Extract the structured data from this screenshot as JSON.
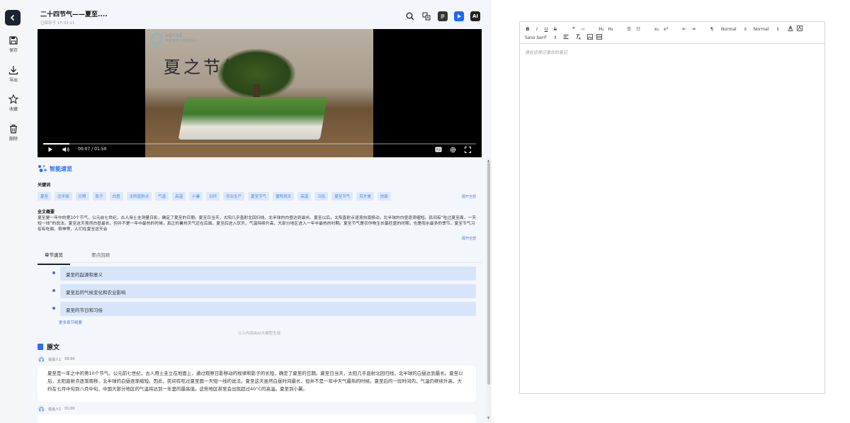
{
  "rail": {
    "back": "back",
    "items": [
      {
        "label": "保存",
        "icon": "save-icon"
      },
      {
        "label": "导出",
        "icon": "download-icon"
      },
      {
        "label": "收藏",
        "icon": "star-icon"
      },
      {
        "label": "删除",
        "icon": "trash-icon"
      }
    ]
  },
  "header": {
    "title": "二十四节气——夏至....",
    "saved_time": "已保存于 17:03:11",
    "icons": [
      "search-icon",
      "translate-icon",
      "notes-icon",
      "play-icon",
      "ai-icon"
    ],
    "ai_label": "AI"
  },
  "video": {
    "logo_text_1": "中国气象局",
    "logo_text_2": "气象宣传与科普中心",
    "title_art": "夏之节气",
    "time": "00:07 / 01:50",
    "progress": 0.06
  },
  "smart": {
    "title": "智能速览",
    "keywords_label": "关键词",
    "keywords": [
      "夏至",
      "北半球",
      "日照",
      "影子",
      "白昼",
      "太阳直射点",
      "气温",
      "高温",
      "小暑",
      "日环",
      "农业生产",
      "夏至节气",
      "雷阵雨天",
      "高温",
      "习俗",
      "夏至节气",
      "苏东坡",
      "饺面"
    ],
    "expand": "展开全部",
    "summary_label": "全文概要",
    "summary": "夏至是一年中的第10个节气，公元前七世纪，古人用土圭测量日影，确定了夏至的日期。夏至日当天，太阳几乎直射北回归线，北半球的白昼达到最长。夏至以后，太阳直射点逐渐向南移动，北半球的白昼逐渐缩短。民间有“吃过夏至面，一天短一线”的说法。夏至这天虽然白昼最长，但并不是一年中最热的时候，真正的暑热天气还在后面。夏至后进入伏天，气温持续升高，大部分地区进入一年中最热的时期。夏至节气是农作物生长最旺盛的时期，也是雨水最多的季节。夏至节气习俗有吃面、祭神等，人们在夏至这天会",
    "summary_expand": "展开全部"
  },
  "tabs": [
    {
      "label": "章节速览",
      "active": true
    },
    {
      "label": "要点回顾",
      "active": false
    }
  ],
  "chapters": [
    "夏至的起源和意义",
    "夏至后的气候变化和农业影响",
    "夏至的节日和习俗"
  ],
  "more_link": "更多章节概要",
  "ai_note": "以上内容由AI大模型生成",
  "original": {
    "title": "原文",
    "entries": [
      {
        "speaker": "说话人1",
        "time": "00:00",
        "text": "夏至是一年之中的第10个节气。公元前七世纪，古人用土圭立在地面上，通过观察日影移动的规律和影子的长短，确定了夏至的日期。夏至日当天，太阳几乎直射北回归线，北半球的白昼达到最长。夏至以后，太阳直射点逐渐南移，北半球的白昼逐渐缩短。因此，民间有吃过夏至面一天短一线的说法。夏至这天虽然白昼时间最长，但并不是一年中天气最热的时候。夏至后的一段时间内，气温仍继续升高，大约在七月中旬到八月中旬，中国大部分地区的气温将达到一年里的最高值。这些地区甚至会出现超过40°C的高温。夏至到小暑。"
      },
      {
        "speaker": "说话人1",
        "time": "01:00",
        "text": ""
      }
    ]
  },
  "editor": {
    "row1": [
      "B",
      "I",
      "U",
      "S",
      "❞",
      "‹›",
      "H₁",
      "H₂",
      "☰",
      "☷",
      "x₂",
      "x²",
      "⇤",
      "⇥",
      "¶"
    ],
    "size_select": "Normal",
    "heading_select": "Normal",
    "row2_font": "Sans Serif",
    "placeholder": "请在这里记录您的笔记"
  },
  "colors": {
    "accent": "#2f6df6",
    "chip_bg": "#dde8fa",
    "chapter_bg": "#d7e5fb"
  }
}
